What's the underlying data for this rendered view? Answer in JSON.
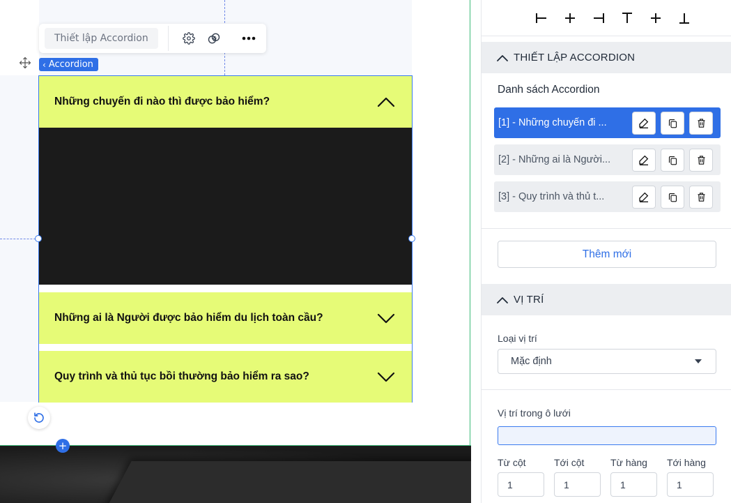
{
  "toolbar": {
    "title": "Thiết lập Accordion"
  },
  "breadcrumb": {
    "label": "Accordion"
  },
  "accordion": {
    "items": [
      {
        "question": "Những chuyến đi nào thì được bảo hiểm?",
        "expanded": true
      },
      {
        "question": "Những ai là Người được bảo hiểm du lịch toàn cầu?",
        "expanded": false
      },
      {
        "question": "Quy trình và thủ tục bồi thường bảo hiểm ra sao?",
        "expanded": false
      }
    ]
  },
  "panel": {
    "accordion_section": {
      "title": "THIẾT LẬP ACCORDION",
      "list_label": "Danh sách Accordion",
      "items": [
        {
          "label": "[1] -  Những chuyến đi ..."
        },
        {
          "label": "[2] -  Những ai là Người..."
        },
        {
          "label": "[3] -  Quy trình và thủ t..."
        }
      ],
      "add_label": "Thêm mới"
    },
    "position_section": {
      "title": "VỊ TRÍ",
      "type_label": "Loại vị trí",
      "type_value": "Mặc định",
      "grid_label": "Vị trí trong ô lưới",
      "from_col_label": "Từ cột",
      "to_col_label": "Tới cột",
      "from_row_label": "Từ hàng",
      "to_row_label": "Tới hàng",
      "from_col": "1",
      "to_col": "1",
      "from_row": "1",
      "to_row": "1"
    }
  },
  "colors": {
    "accent": "#2f6fe6",
    "accordion_header": "#e6fb77",
    "accordion_body": "#1b1b1b",
    "selection": "#3b7bef"
  }
}
